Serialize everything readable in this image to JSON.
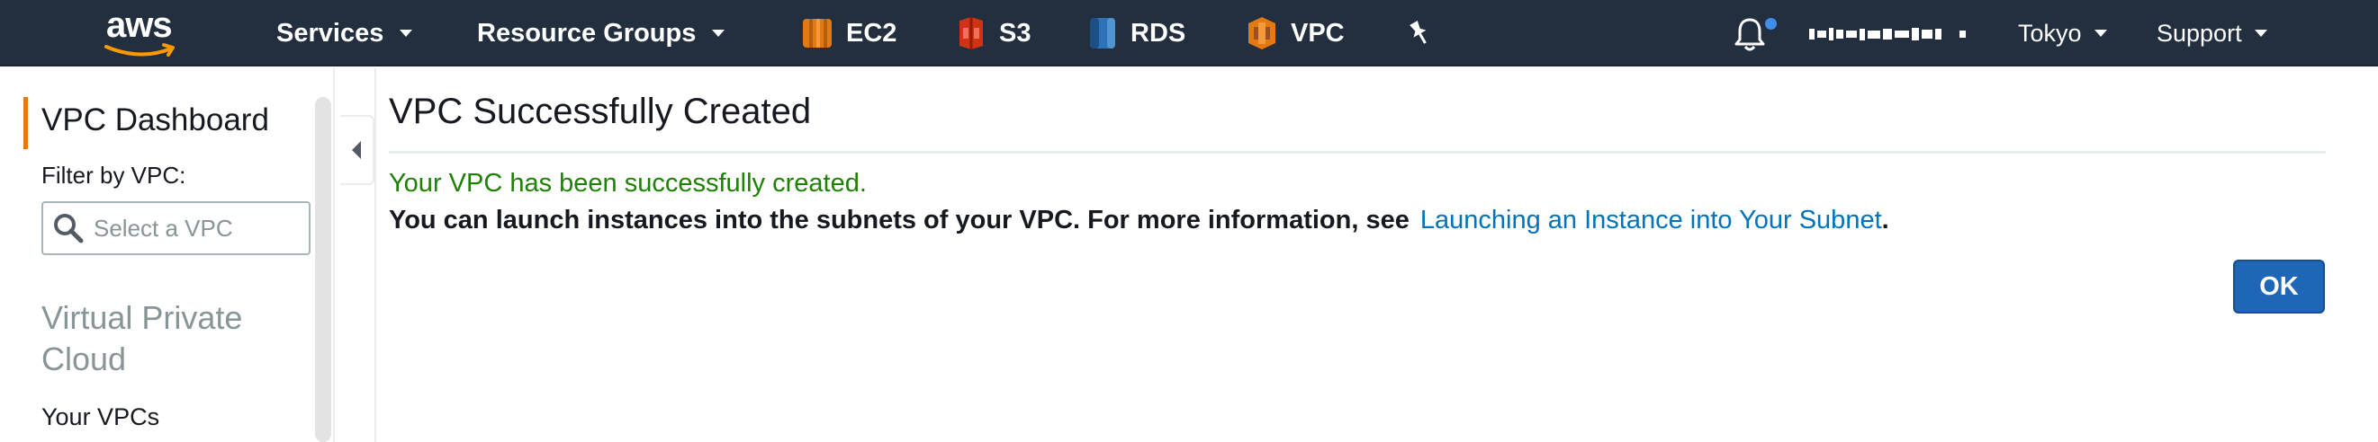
{
  "nav": {
    "logo_text": "aws",
    "services_label": "Services",
    "resource_groups_label": "Resource Groups",
    "shortcuts": [
      {
        "label": "EC2",
        "icon": "ec2-icon",
        "color": "#e47911"
      },
      {
        "label": "S3",
        "icon": "s3-icon",
        "color": "#d13212"
      },
      {
        "label": "RDS",
        "icon": "rds-icon",
        "color": "#2e73b8"
      },
      {
        "label": "VPC",
        "icon": "vpc-icon",
        "color": "#e47911"
      }
    ],
    "region_label": "Tokyo",
    "support_label": "Support",
    "pin_icon": "pin-icon",
    "bell_icon": "bell-icon",
    "notification_dot_color": "#3f8fe8",
    "background": "#232f3e"
  },
  "sidebar": {
    "dashboard_label": "VPC Dashboard",
    "filter_label": "Filter by VPC:",
    "filter_placeholder": "Select a VPC",
    "section_title": "Virtual Private Cloud",
    "items": [
      {
        "label": "Your VPCs"
      }
    ],
    "accent_color": "#e47911"
  },
  "main": {
    "title": "VPC Successfully Created",
    "success_message": "Your VPC has been successfully created.",
    "info_text": "You can launch instances into the subnets of your VPC. For more information, see",
    "info_link": "Launching an Instance into Your Subnet",
    "info_period": ".",
    "ok_label": "OK",
    "success_color": "#1d8102",
    "link_color": "#0073bb",
    "button_color": "#1f66b6"
  }
}
